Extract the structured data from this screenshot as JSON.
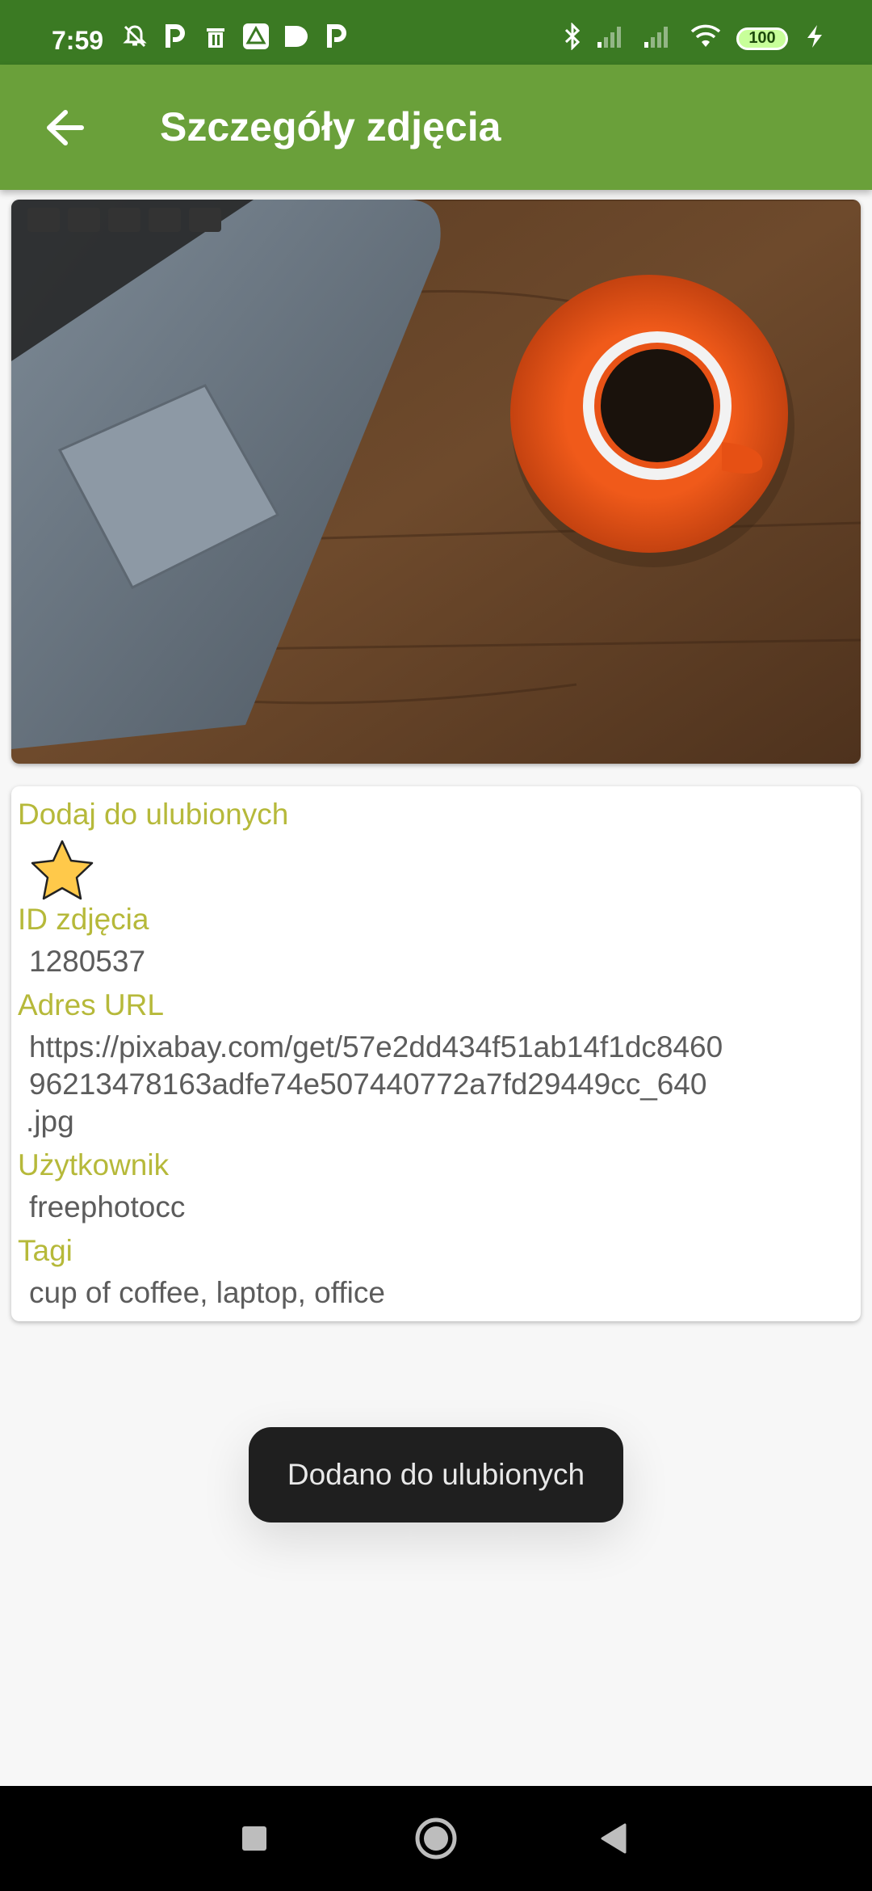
{
  "status_bar": {
    "time": "7:59",
    "left_icons": [
      "bell-off-icon",
      "parking-icon",
      "trash-icon",
      "drive-icon",
      "play-icon",
      "parking-icon"
    ],
    "right_icons": [
      "bluetooth-icon",
      "signal-icon",
      "signal-icon",
      "wifi-icon"
    ],
    "battery": "100"
  },
  "app_bar": {
    "back_icon": "arrow-left-icon",
    "title": "Szczegóły zdjęcia",
    "color": "#6aa03a"
  },
  "photo": {
    "subject": "laptop and cup of coffee on wooden desk"
  },
  "details": {
    "favorite_label": "Dodaj do ulubionych",
    "favorite_icon": "star-icon",
    "id_label": "ID zdjęcia",
    "id_value": "1280537",
    "url_label": "Adres URL",
    "url_line1": "https://pixabay.com/get/57e2dd434f51ab14f1dc8460",
    "url_line2": "96213478163adfe74e507440772a7fd29449cc_640",
    "url_line3": ".jpg",
    "user_label": "Użytkownik",
    "user_value": "freephotocc",
    "tags_label": "Tagi",
    "tags_value": "cup of coffee, laptop, office",
    "label_color": "#b6b93a"
  },
  "toast": {
    "text": "Dodano do ulubionych"
  },
  "nav_bar": {
    "icons": [
      "recents-square-icon",
      "home-circle-icon",
      "back-triangle-icon"
    ]
  }
}
